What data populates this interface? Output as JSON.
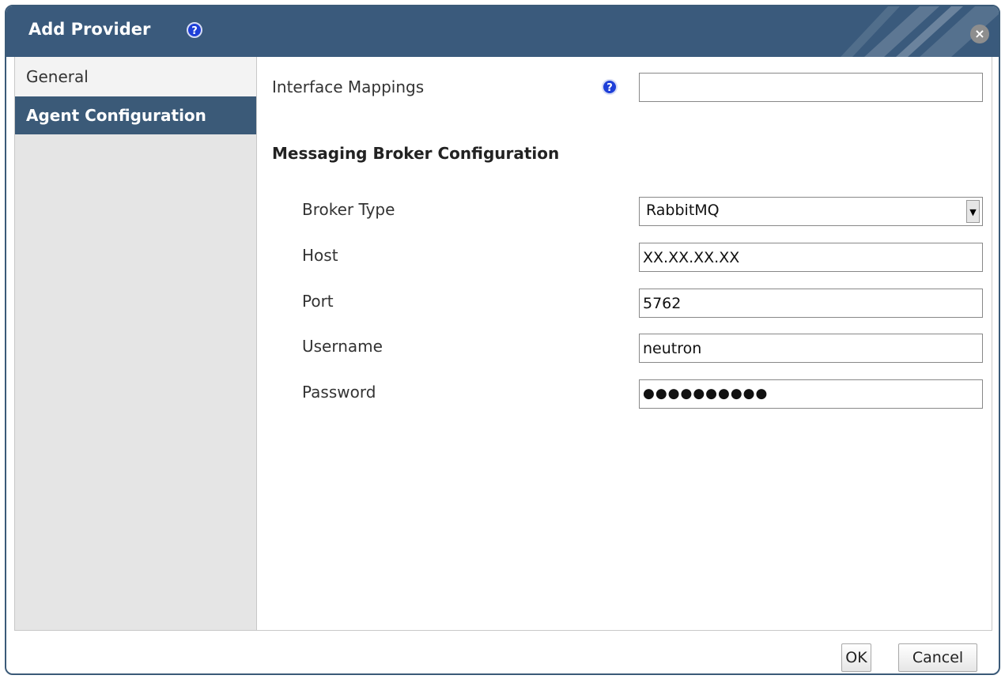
{
  "dialog": {
    "title": "Add Provider",
    "help_icon": "?",
    "close_icon": "×"
  },
  "sidebar": {
    "items": [
      {
        "label": "General"
      },
      {
        "label": "Agent Configuration"
      }
    ]
  },
  "agent": {
    "interface_mappings_label": "Interface Mappings",
    "interface_mappings_value": "",
    "help_icon": "?",
    "section_title": "Messaging Broker Configuration",
    "broker_type_label": "Broker Type",
    "broker_type_value": "RabbitMQ",
    "host_label": "Host",
    "host_value": "XX.XX.XX.XX",
    "port_label": "Port",
    "port_value": "5762",
    "username_label": "Username",
    "username_value": "neutron",
    "password_label": "Password",
    "password_value": "●●●●●●●●●●"
  },
  "footer": {
    "ok_label": "OK",
    "cancel_label": "Cancel"
  },
  "colors": {
    "titlebar": "#3a5a7c",
    "active_tab": "#3b5a78",
    "help_icon": "#1e3fd8"
  }
}
